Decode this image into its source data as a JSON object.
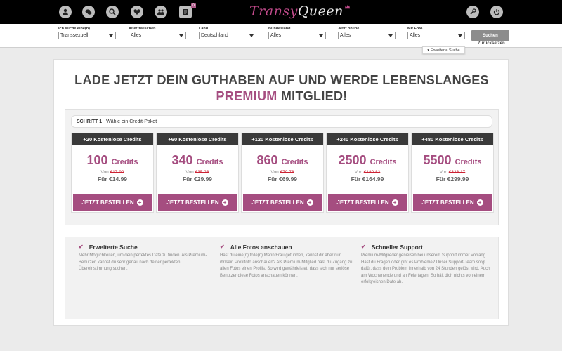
{
  "nav": {
    "left_icons": [
      "user-icon",
      "chat-icon",
      "search-icon",
      "heart-icon",
      "users-icon",
      "notes-icon"
    ],
    "notes_badge": "0",
    "logo_part1": "Transy",
    "logo_part2": "Queen",
    "right_icons": [
      "wrench-icon",
      "power-icon"
    ]
  },
  "filters": [
    {
      "label": "Ich suche eine(n)",
      "value": "Transsexuell"
    },
    {
      "label": "Alter zwischen",
      "value": "Alles"
    },
    {
      "label": "Land",
      "value": "Deutschland"
    },
    {
      "label": "Bundesland",
      "value": "Alles"
    },
    {
      "label": "Jetzt online",
      "value": "Alles"
    },
    {
      "label": "Mit Foto",
      "value": "Alles"
    }
  ],
  "search_button": "Suchen",
  "reset_link": "Zurücksetzen",
  "advanced_search": "▾ Erweiterte Suche",
  "headline": {
    "line1": "LADE JETZT DEIN GUTHABEN AUF UND WERDE LEBENSLANGES",
    "premium": "PREMIUM",
    "line2_rest": " MITGLIED!"
  },
  "step": {
    "label": "SCHRITT 1",
    "text": "Wähle ein Credit-Paket"
  },
  "packages": [
    {
      "header": "+20 Kostenlose Credits",
      "amount": "100",
      "unit": "Credits",
      "from_label": "Von",
      "old_price": "€17.99",
      "price": "Für €14.99",
      "button": "JETZT BESTELLEN"
    },
    {
      "header": "+60 Kostenlose Credits",
      "amount": "340",
      "unit": "Credits",
      "from_label": "Von",
      "old_price": "€35.26",
      "price": "Für €29.99",
      "button": "JETZT BESTELLEN"
    },
    {
      "header": "+120 Kostenlose Credits",
      "amount": "860",
      "unit": "Credits",
      "from_label": "Von",
      "old_price": "€79.76",
      "price": "Für €69.99",
      "button": "JETZT BESTELLEN"
    },
    {
      "header": "+240 Kostenlose Credits",
      "amount": "2500",
      "unit": "Credits",
      "from_label": "Von",
      "old_price": "€180.83",
      "price": "Für €164.99",
      "button": "JETZT BESTELLEN"
    },
    {
      "header": "+480 Kostenlose Credits",
      "amount": "5500",
      "unit": "Credits",
      "from_label": "Von",
      "old_price": "€326.17",
      "price": "Für €299.99",
      "button": "JETZT BESTELLEN"
    }
  ],
  "features": [
    {
      "title": "Erweiterte Suche",
      "text": "Mehr Möglichkeiten, um dein perfektes Date zu finden. Als Premium-Benutzer, kannst du sehr genau nach deiner perfekten Übereinstimmung suchen."
    },
    {
      "title": "Alle Fotos anschauen",
      "text": "Hast du eine(n) tolle(n) Mann/Frau gefunden, kannst dir aber nur ihr/sein Profilfoto anschauen? Als Premium-Mitglied hast du Zugang zu allen Fotos einen Profils. So wird gewährleistet, dass sich nur seriöse Benutzer diese Fotos anschauen können."
    },
    {
      "title": "Schneller Support",
      "text": "Premium-Mitglieder genießen bei unserem Support immer Vorrang. Hast du Fragen oder gibt es Probleme? Unser Support-Team sorgt dafür, dass dein Problem innerhalb von 24 Stunden gelöst wird. Auch am Wochenende und an Feiertagen. So hält dich nichts von einem erfolgreichen Date ab."
    }
  ],
  "colors": {
    "accent": "#a54d80",
    "header_dark": "#3a3a3a",
    "topbar": "#000000"
  }
}
